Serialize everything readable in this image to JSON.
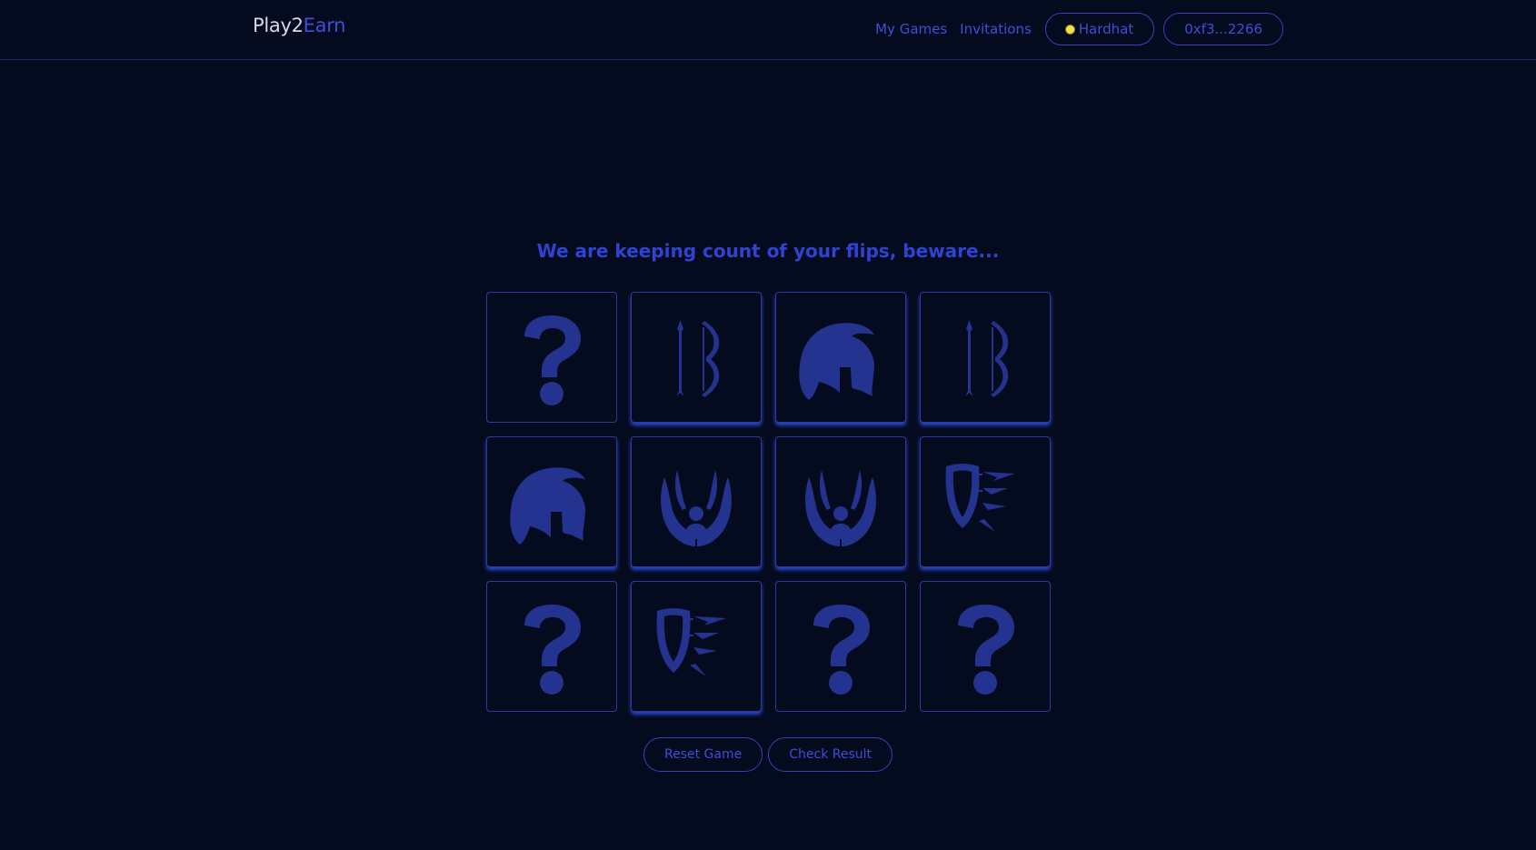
{
  "header": {
    "logo_part1": "Play2",
    "logo_part2": "Earn",
    "nav": {
      "my_games": "My Games",
      "invitations": "Invitations"
    },
    "network_label": "Hardhat",
    "account_label": "0xf3...2266"
  },
  "game": {
    "headline": "We are keeping count of your flips, beware...",
    "cards": [
      {
        "icon": "question-mark-icon",
        "flipped": false
      },
      {
        "icon": "bow-and-arrow-icon",
        "flipped": true
      },
      {
        "icon": "spartan-helmet-icon",
        "flipped": true
      },
      {
        "icon": "bow-and-arrow-icon",
        "flipped": true
      },
      {
        "icon": "spartan-helmet-icon",
        "flipped": true
      },
      {
        "icon": "winged-figure-icon",
        "flipped": true
      },
      {
        "icon": "winged-figure-icon",
        "flipped": true
      },
      {
        "icon": "shield-and-arrows-icon",
        "flipped": true
      },
      {
        "icon": "question-mark-icon",
        "flipped": false
      },
      {
        "icon": "shield-and-arrows-icon",
        "flipped": true
      },
      {
        "icon": "question-mark-icon",
        "flipped": false
      },
      {
        "icon": "question-mark-icon",
        "flipped": false
      }
    ],
    "reset_label": "Reset Game",
    "check_label": "Check Result"
  },
  "colors": {
    "background": "#050b1f",
    "accent": "#3d4fd8",
    "icon": "#24338f",
    "card_border": "#2c3a9c",
    "glow": "#3454f0"
  }
}
